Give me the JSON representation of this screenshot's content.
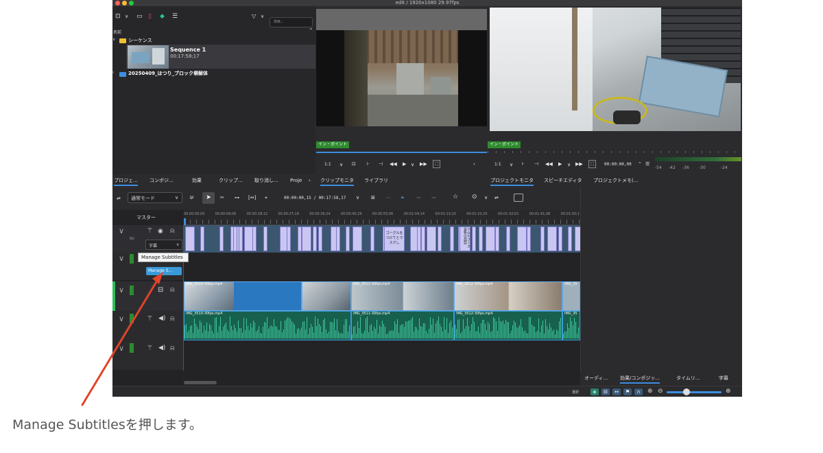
{
  "window": {
    "title": "edit / 1920x1080 29.97fps"
  },
  "bin": {
    "search_placeholder": "検索...",
    "column_name": "名前",
    "folder_sequences": "シーケンス",
    "sequence_name": "Sequence 1",
    "sequence_duration": "00:17:58;17",
    "folder_project": "20250409_はつり_ブロック塀解体"
  },
  "left_tabs": [
    "プロジェ...",
    "コンポジ...",
    "効果",
    "クリップ...",
    "取り消し...",
    "Proje"
  ],
  "clip_monitor": {
    "in_point": "イン・ポイント",
    "zoom": "1:1",
    "tabs": [
      "クリップモニタ",
      "ライブラリ"
    ]
  },
  "project_monitor": {
    "in_point": "イン・ポイント",
    "zoom": "1:1",
    "timecode": "00:00:00,00",
    "tabs": [
      "プロジェクトモニタ",
      "スピーチエディタ",
      "プロジェクトメモ(..."
    ],
    "meter_labels": [
      "-54",
      "-42",
      "-36",
      "-30",
      "-24"
    ]
  },
  "timeline_toolbar": {
    "mode": "通常モード",
    "timecode": "00:00:00,15 / 00:17:58,17"
  },
  "timeline": {
    "master_label": "マスター",
    "ruler": [
      "00:00:00;00",
      "00:00:09;06",
      "00:00:18;12",
      "00:00:27;18",
      "00:00:36;24",
      "00:00:45;29",
      "00:00:55;06",
      "00:01:04;14",
      "00:01:13;20",
      "00:01:22;25",
      "00:01:32;01",
      "00:01:41;08",
      "00:01:50;1"
    ],
    "subtitle_dropdown": "字幕",
    "tooltip": "Manage Subtitles",
    "manage_button": "Manage S...",
    "video_clips": [
      "IMG_3510-30fps.mp4",
      "IMG_3511-30fps.mp4",
      "IMG_3512-30fps.mp4",
      "IMG_35"
    ],
    "audio_clips": [
      "IMG_3510-30fps.mp4",
      "IMG_3511-30fps.mp4",
      "IMG_3512-30fps.mp4",
      "IMG_35"
    ],
    "subtitle_snippets": [
      "ゴーグルをつけてとマスクし",
      "トムルフーズ全新の品目"
    ]
  },
  "right_tabs": [
    "オーディ...",
    "効果/コンポジッ...",
    "タイムリ...",
    "字幕"
  ],
  "statusbar": {
    "select_label": "選択"
  },
  "caption": "Manage Subtitlesを押します。",
  "colors": {
    "accent": "#3d8ee0",
    "arrow": "#e0442a",
    "in_point": "#2e8b2e",
    "subtitle": "#c9c6f2",
    "audio": "#18604e"
  }
}
